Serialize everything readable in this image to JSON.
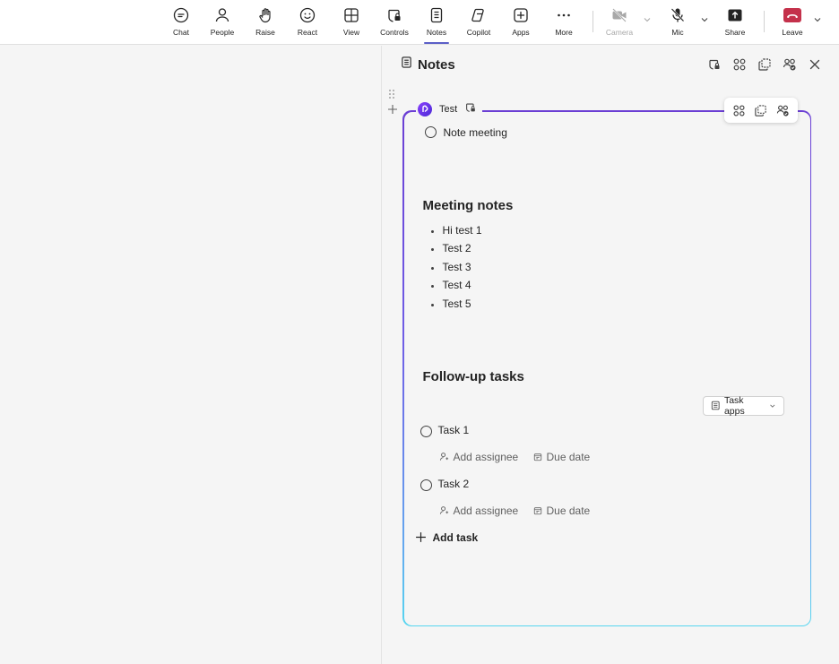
{
  "toolbar": {
    "chat": "Chat",
    "people": "People",
    "raise": "Raise",
    "react": "React",
    "view": "View",
    "controls": "Controls",
    "notes": "Notes",
    "copilot": "Copilot",
    "apps": "Apps",
    "more": "More",
    "camera": "Camera",
    "mic": "Mic",
    "share": "Share",
    "leave": "Leave"
  },
  "panel": {
    "title": "Notes"
  },
  "loop": {
    "name": "Test",
    "agenda_item": "Note meeting",
    "meeting_notes_heading": "Meeting notes",
    "notes": [
      "Hi test 1",
      "Test 2",
      "Test 3",
      "Test 4",
      "Test 5"
    ],
    "followup_heading": "Follow-up tasks",
    "task_apps_label": "Task apps",
    "tasks": [
      {
        "title": "Task 1",
        "assignee": "Add assignee",
        "due": "Due date"
      },
      {
        "title": "Task 2",
        "assignee": "Add assignee",
        "due": "Due date"
      }
    ],
    "add_task": "Add task"
  },
  "colors": {
    "accent": "#5b5fc7",
    "leave": "#c4314b",
    "loop_border_top": "#6b3fd4",
    "loop_border_bottom": "#56d6f0"
  }
}
